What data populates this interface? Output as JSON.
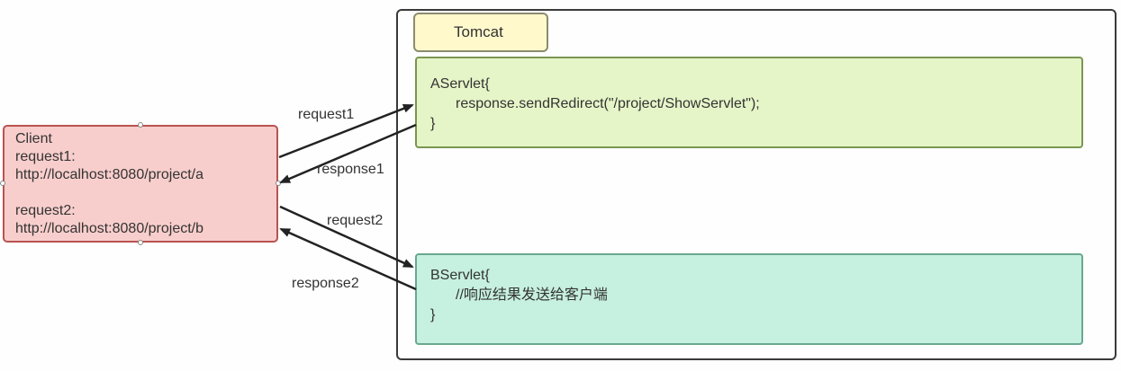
{
  "client": {
    "title": "Client",
    "request1_label": "request1:",
    "request1_url": "http://localhost:8080/project/a",
    "request2_label": "request2:",
    "request2_url": "http://localhost:8080/project/b"
  },
  "tomcat": {
    "label": "Tomcat"
  },
  "aservlet": {
    "line1": "AServlet{",
    "line2": "response.sendRedirect(\"/project/ShowServlet\");",
    "line3": "}"
  },
  "bservlet": {
    "line1": "BServlet{",
    "line2": "//响应结果发送给客户端",
    "line3": "}"
  },
  "arrows": {
    "request1": "request1",
    "response1": "response1",
    "request2": "request2",
    "response2": "response2"
  },
  "colors": {
    "client_fill": "#f8cecc",
    "client_stroke": "#b85450",
    "tomcat_label_fill": "#fff9cc",
    "aservlet_fill": "#e6f5c8",
    "bservlet_fill": "#c6f0e0",
    "arrow": "#222222"
  }
}
